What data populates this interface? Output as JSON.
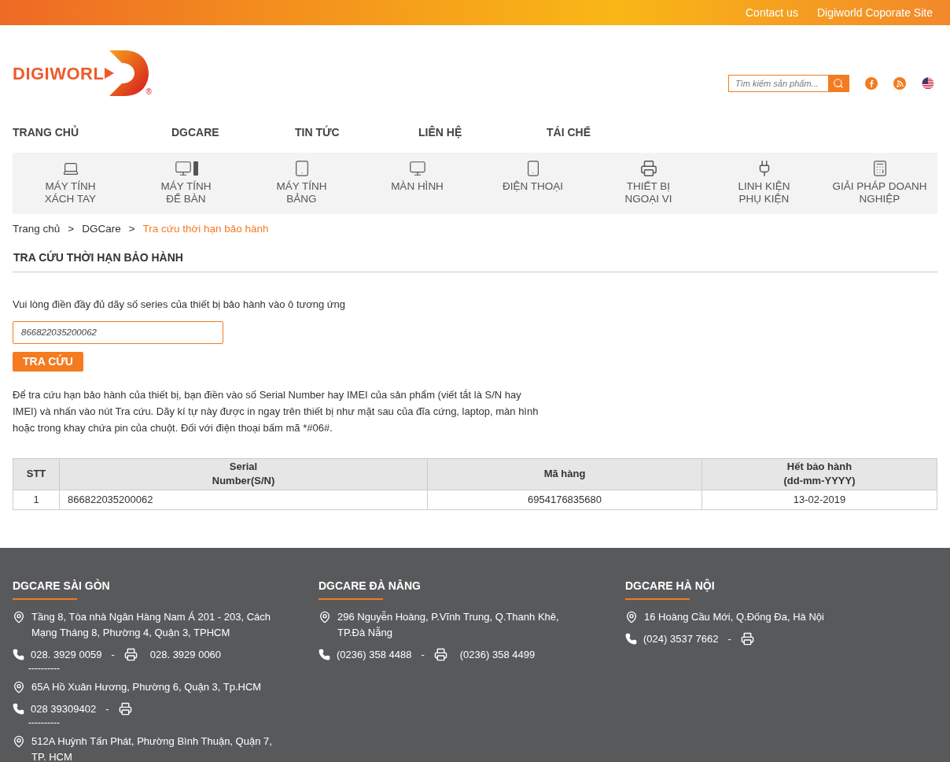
{
  "top_links": [
    "Contact us",
    "Digiworld Coporate Site"
  ],
  "logo": {
    "text": "DIGIWORL",
    "mark": "®"
  },
  "search": {
    "placeholder": "Tìm kiếm sản phẩm..."
  },
  "main_nav": [
    "TRANG CHỦ",
    "DGCARE",
    "TIN TỨC",
    "LIÊN HỆ",
    "TÁI CHẾ"
  ],
  "categories": [
    {
      "kind": "laptop",
      "lines": [
        "MÁY TÍNH",
        "XÁCH TAY"
      ]
    },
    {
      "kind": "desktop",
      "lines": [
        "MÁY TÍNH",
        "ĐỂ BÀN"
      ]
    },
    {
      "kind": "tablet",
      "lines": [
        "MÁY TÍNH",
        "BẢNG"
      ]
    },
    {
      "kind": "monitor",
      "lines": [
        "MÀN HÌNH"
      ]
    },
    {
      "kind": "phone",
      "lines": [
        "ĐIỆN THOẠI"
      ]
    },
    {
      "kind": "printer",
      "lines": [
        "THIẾT BỊ",
        "NGOẠI VI"
      ]
    },
    {
      "kind": "plug",
      "lines": [
        "LINH KIỆN",
        "PHỤ KIỆN"
      ]
    },
    {
      "kind": "terminal",
      "lines": [
        "GIẢI PHÁP DOANH",
        "NGHIỆP"
      ]
    }
  ],
  "breadcrumb": [
    {
      "label": "Trang chủ",
      "current": false
    },
    {
      "label": "DGCare",
      "current": false
    },
    {
      "label": "Tra cứu thời hạn bảo hành",
      "current": true
    }
  ],
  "breadcrumb_separator": ">",
  "page_title": "TRA CỨU THỜI HẠN BẢO HÀNH",
  "instruction": "Vui lòng điền đầy đủ dãy số series của thiết bị bảo hành vào ô tương ứng",
  "serial_input": {
    "value": "866822035200062"
  },
  "lookup_button": "TRA CỨU",
  "help_text": "Để tra cứu hạn bảo hành của thiết bị, bạn điền vào số Serial Number hay IMEI của sản phẩm (viết tắt là S/N hay IMEI) và nhấn vào nút Tra cứu. Dãy kí tự này được in ngay trên thiết bị như mặt sau của đĩa cứng, laptop, màn hình hoặc trong khay chứa pin của chuột. Đối với điện thoại bấm mã *#06#.",
  "table": {
    "columns": [
      "STT",
      "Serial Number(S/N)",
      "Mã hàng",
      "Hết bảo hành (dd-mm-YYYY)"
    ],
    "rows": [
      [
        "1",
        "866822035200062",
        "6954176835680",
        "13-02-2019"
      ]
    ]
  },
  "footer": [
    {
      "title": "DGCARE SÀI GÒN",
      "items": [
        {
          "kind": "address",
          "text": "Tầng 8, Tòa nhà Ngân Hàng Nam Á 201 - 203, Cách Mạng Tháng 8, Phường 4, Quận 3, TPHCM"
        },
        {
          "kind": "phone",
          "phone": "028. 3929 0059",
          "dash": "-",
          "fax": "028. 3929 0060"
        },
        {
          "kind": "separator",
          "text": "----------"
        },
        {
          "kind": "address",
          "text": "65A Hồ Xuân Hương, Phường 6, Quận 3, Tp.HCM"
        },
        {
          "kind": "phone",
          "phone": "028 39309402",
          "dash": "-"
        },
        {
          "kind": "separator",
          "text": "----------"
        },
        {
          "kind": "address",
          "text": "512A Huỳnh Tấn Phát, Phường Bình Thuận, Quận 7, TP. HCM"
        }
      ]
    },
    {
      "title": "DGCARE ĐÀ NẴNG",
      "items": [
        {
          "kind": "address",
          "text": "296 Nguyễn Hoàng, P.Vĩnh Trung, Q.Thanh Khê, TP.Đà Nẵng"
        },
        {
          "kind": "phone",
          "phone": "(0236) 358 4488",
          "dash": "-",
          "fax": "(0236) 358 4499"
        }
      ]
    },
    {
      "title": "DGCARE HÀ NỘI",
      "items": [
        {
          "kind": "address",
          "text": "16 Hoàng Cầu Mới, Q.Đống Đa, Hà Nội"
        },
        {
          "kind": "phone",
          "phone": "(024) 3537 7662",
          "dash": "-"
        }
      ]
    }
  ]
}
